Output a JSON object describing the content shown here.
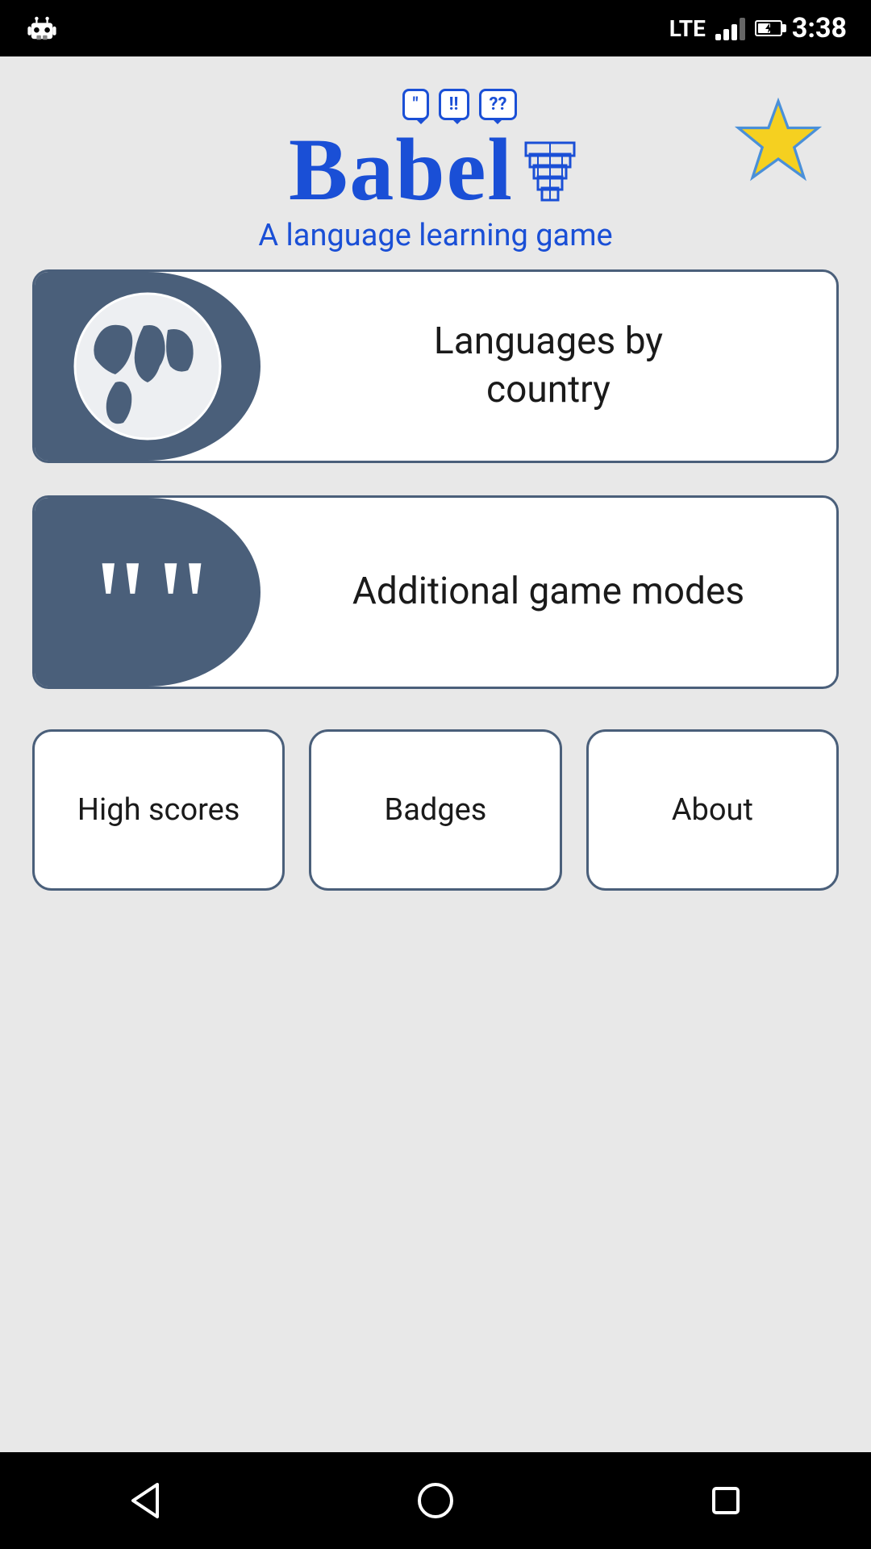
{
  "statusBar": {
    "time": "3:38",
    "network": "LTE",
    "robotIcon": "robot"
  },
  "header": {
    "logoText": "Babel",
    "subtitle": "A language learning game",
    "starIcon": "star"
  },
  "buttons": {
    "languagesByCountry": {
      "label": "Languages by\ncountry",
      "icon": "globe-icon"
    },
    "additionalGameModes": {
      "label": "Additional game modes",
      "icon": "quote-icon"
    }
  },
  "bottomButtons": {
    "highScores": "High scores",
    "badges": "Badges",
    "about": "About"
  },
  "navBar": {
    "back": "◁",
    "home": "○",
    "recent": "□"
  }
}
